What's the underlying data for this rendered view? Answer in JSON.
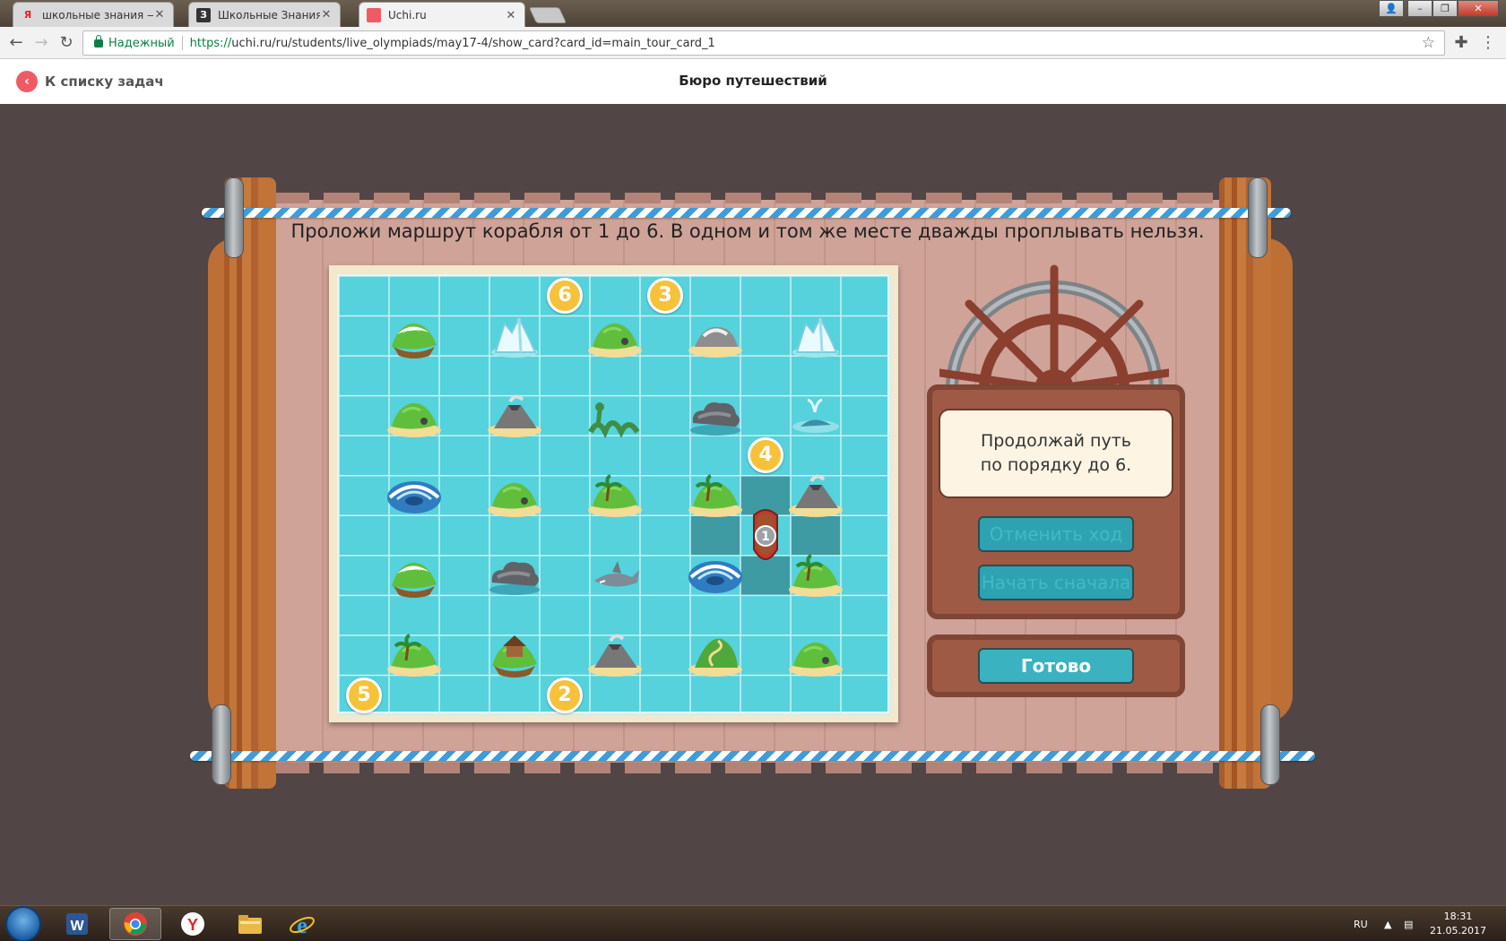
{
  "browser": {
    "tabs": [
      {
        "title": "школьные знания — Ян",
        "favicon": "Я",
        "favicon_color": "#e52620"
      },
      {
        "title": "Школьные Знания.com",
        "favicon": "З",
        "favicon_color": "#333333"
      },
      {
        "title": "Uchi.ru",
        "favicon": "",
        "favicon_color": "#ef5b64"
      }
    ],
    "secure_label": "Надежный",
    "url_scheme": "https://",
    "url_rest": "uchi.ru/ru/students/live_olympiads/may17-4/show_card?card_id=main_tour_card_1"
  },
  "page": {
    "back_label": "К списку задач",
    "title": "Бюро путешествий"
  },
  "game": {
    "instruction": "Проложи маршрут корабля от 1 до 6. В одном и том же месте дважды проплывать нельзя.",
    "hint_line1": "Продолжай путь",
    "hint_line2": "по порядку до 6.",
    "undo_label": "Отменить ход",
    "restart_label": "Начать сначала",
    "done_label": "Готово",
    "grid": {
      "cols": 11,
      "rows": 11
    },
    "numbers": [
      {
        "label": "6",
        "col": 4,
        "row": 0
      },
      {
        "label": "3",
        "col": 6,
        "row": 0
      },
      {
        "label": "4",
        "col": 8,
        "row": 4
      },
      {
        "label": "5",
        "col": 0,
        "row": 10
      },
      {
        "label": "2",
        "col": 4,
        "row": 10
      }
    ],
    "ship": {
      "label": "1",
      "col": 8,
      "row": 6
    },
    "highlight_cells": [
      {
        "col": 8,
        "row": 5
      },
      {
        "col": 7,
        "row": 6
      },
      {
        "col": 9,
        "row": 6
      },
      {
        "col": 8,
        "row": 7
      }
    ],
    "islands": [
      {
        "col": 1,
        "row": 1,
        "kind": "snow-island"
      },
      {
        "col": 3,
        "row": 1,
        "kind": "iceberg"
      },
      {
        "col": 5,
        "row": 1,
        "kind": "green-island"
      },
      {
        "col": 7,
        "row": 1,
        "kind": "rock-island"
      },
      {
        "col": 9,
        "row": 1,
        "kind": "iceberg"
      },
      {
        "col": 1,
        "row": 3,
        "kind": "green-island"
      },
      {
        "col": 3,
        "row": 3,
        "kind": "volcano-island"
      },
      {
        "col": 5,
        "row": 3,
        "kind": "sea-serpent"
      },
      {
        "col": 7,
        "row": 3,
        "kind": "storm-cloud"
      },
      {
        "col": 9,
        "row": 3,
        "kind": "whale"
      },
      {
        "col": 1,
        "row": 5,
        "kind": "whirlpool"
      },
      {
        "col": 3,
        "row": 5,
        "kind": "green-island"
      },
      {
        "col": 5,
        "row": 5,
        "kind": "palm-island"
      },
      {
        "col": 7,
        "row": 5,
        "kind": "palm-island"
      },
      {
        "col": 9,
        "row": 5,
        "kind": "volcano-island"
      },
      {
        "col": 1,
        "row": 7,
        "kind": "snow-island"
      },
      {
        "col": 3,
        "row": 7,
        "kind": "storm-cloud"
      },
      {
        "col": 5,
        "row": 7,
        "kind": "shark"
      },
      {
        "col": 7,
        "row": 7,
        "kind": "whirlpool"
      },
      {
        "col": 9,
        "row": 7,
        "kind": "palm-island"
      },
      {
        "col": 1,
        "row": 9,
        "kind": "palm-island"
      },
      {
        "col": 3,
        "row": 9,
        "kind": "hut-island"
      },
      {
        "col": 5,
        "row": 9,
        "kind": "volcano-island"
      },
      {
        "col": 7,
        "row": 9,
        "kind": "path-island"
      },
      {
        "col": 9,
        "row": 9,
        "kind": "green-island"
      }
    ],
    "colors": {
      "water": "#55d2dc",
      "highlight": "#3e9ba3",
      "number": "#f6c23a",
      "ship": "#c0392b"
    }
  },
  "taskbar": {
    "lang": "RU",
    "time": "18:31",
    "date": "21.05.2017",
    "apps": [
      "word-icon",
      "chrome-icon",
      "yandex-icon",
      "explorer-icon",
      "ie-icon"
    ]
  }
}
